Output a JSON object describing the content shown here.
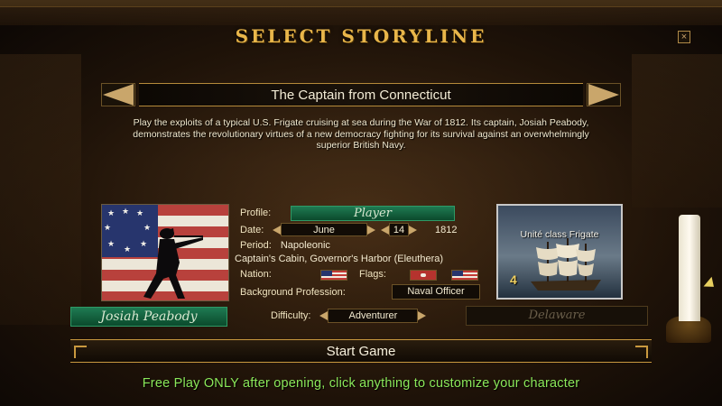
{
  "screen": {
    "title": "SELECT STORYLINE",
    "close_label": "×"
  },
  "storyline": {
    "name": "The Captain from Connecticut",
    "description": "Play the exploits of a typical U.S. Frigate cruising at sea during the War of 1812. Its captain, Josiah Peabody, demonstrates the revolutionary virtues of a new democracy fighting for its survival against an overwhelmingly superior British Navy."
  },
  "character": {
    "profile_label": "Profile:",
    "profile_value": "Player",
    "date_label": "Date:",
    "date_month": "June",
    "date_day": "14",
    "date_year": "1812",
    "period_label": "Period:",
    "period_value": "Napoleonic",
    "location": "Captain's Cabin, Governor's Harbor (Eleuthera)",
    "nation_label": "Nation:",
    "flags_label": "Flags:",
    "background_label": "Background Profession:",
    "background_value": "Naval Officer",
    "name": "Josiah Peabody",
    "difficulty_label": "Difficulty:",
    "difficulty_value": "Adventurer",
    "home_port": "Delaware"
  },
  "ship": {
    "name": "Unité class Frigate",
    "tier": "4"
  },
  "actions": {
    "start_game": "Start Game"
  },
  "footer": {
    "hint": "Free Play ONLY after opening, click anything to customize your character"
  },
  "colors": {
    "title_gold": "#e9b64a",
    "accent_green": "#1f7a52",
    "footer_green": "#8be85a"
  }
}
